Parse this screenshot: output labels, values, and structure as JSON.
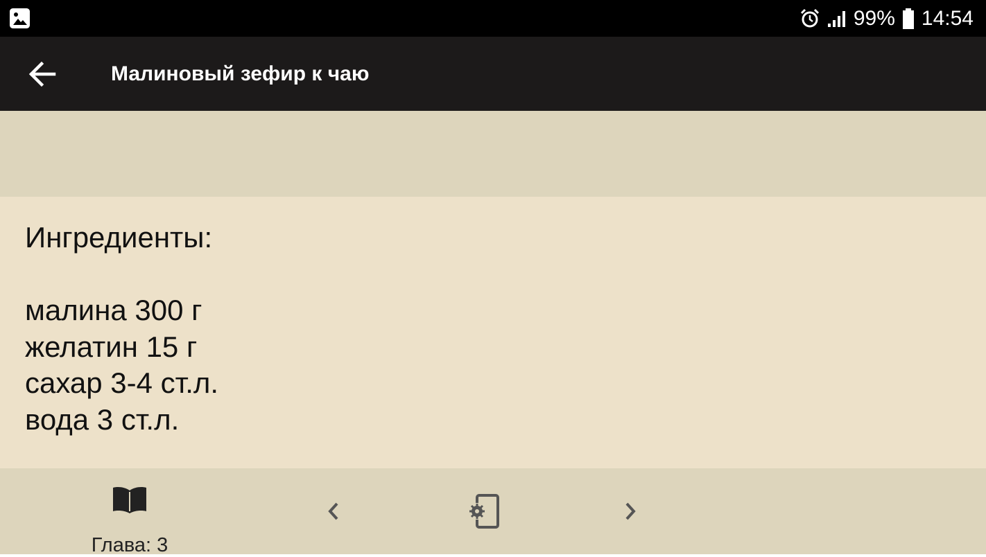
{
  "status_bar": {
    "left_icon": "image-icon",
    "alarm_icon": "alarm-icon",
    "signal_icon": "signal-icon",
    "battery_percent": "99%",
    "battery_icon": "battery-icon",
    "time": "14:54"
  },
  "app_bar": {
    "back_icon": "arrow-left-icon",
    "title": "Малиновый зефир к чаю"
  },
  "content": {
    "heading": "Ингредиенты:",
    "ingredients": [
      "малина 300 г",
      "желатин 15 г",
      "сахар 3-4 ст.л.",
      "вода 3 ст.л."
    ]
  },
  "bottom_bar": {
    "chapter_icon": "book-icon",
    "chapter_label": "Глава: 3",
    "prev_icon": "chevron-left-icon",
    "settings_icon": "phone-settings-icon",
    "next_icon": "chevron-right-icon"
  },
  "colors": {
    "status_bar": "#000000",
    "app_bar": "#1c1a1a",
    "band": "#ddd5bc",
    "content_bg": "#ede1c9",
    "text": "#111111"
  }
}
